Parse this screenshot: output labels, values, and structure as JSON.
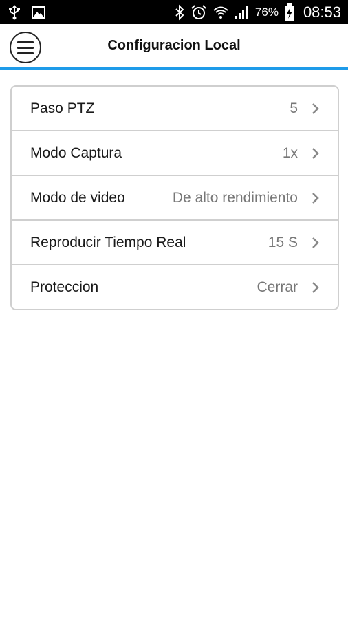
{
  "status_bar": {
    "battery_percent": "76%",
    "time": "08:53",
    "icons": [
      "usb-icon",
      "image-icon",
      "bluetooth-icon",
      "alarm-icon",
      "wifi-icon",
      "signal-icon",
      "battery-charging-icon"
    ]
  },
  "header": {
    "title": "Configuracion Local",
    "accent_color": "#1e9be9"
  },
  "settings": [
    {
      "label": "Paso PTZ",
      "value": "5"
    },
    {
      "label": "Modo Captura",
      "value": "1x"
    },
    {
      "label": "Modo de video",
      "value": "De alto rendimiento"
    },
    {
      "label": "Reproducir Tiempo Real",
      "value": "15 S"
    },
    {
      "label": "Proteccion",
      "value": "Cerrar"
    }
  ]
}
